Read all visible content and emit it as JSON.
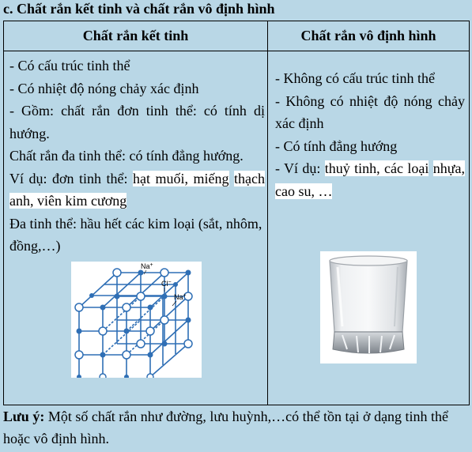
{
  "heading": "c. Chất rắn kết tinh và chất rắn vô định hình",
  "table": {
    "headers": [
      "Chất rắn kết tinh",
      "Chất rắn vô định hình"
    ],
    "crystalline": {
      "line1": "- Có cấu trúc tinh thể",
      "line2": "- Có nhiệt độ nóng chảy xác định",
      "line3": "- Gồm: chất rắn đơn tinh thể: có tính dị hướng.",
      "line4": "Chất rắn đa tinh thể: có tính đẳng hướng.",
      "example_prefix": "Ví dụ: đơn tinh thể: ",
      "example_hl1": "hạt muối, miếng",
      "example_hl2": "thạch anh, viên kim cương",
      "poly_example": "Đa tinh thể: hầu hết các kim loại (sắt, nhôm, đồng,…)",
      "figure_labels": {
        "na_top": "Na",
        "na_right": "Na",
        "cl": "Cl",
        "plus": "+",
        "minus": "−"
      }
    },
    "amorphous": {
      "line1": "- Không có cấu trúc tinh thể",
      "line2": "- Không có nhiệt độ nóng chảy xác định",
      "line3": "- Có tính đẳng hướng",
      "example_prefix": "- Ví dụ: ",
      "example_hl1": "thuỷ tinh, các loại",
      "example_hl2": "nhựa, cao su, …"
    }
  },
  "note": {
    "label": "Lưu ý:",
    "text": " Một số chất rắn như đường, lưu huỳnh,…có thể tồn tại ở dạng tinh thể hoặc vô định hình."
  },
  "colors": {
    "background": "#b9d7e6",
    "highlight": "#ffffff",
    "lattice": "#2f6fb5"
  },
  "icons": [
    "nacl-crystal-lattice",
    "drinking-glass"
  ]
}
